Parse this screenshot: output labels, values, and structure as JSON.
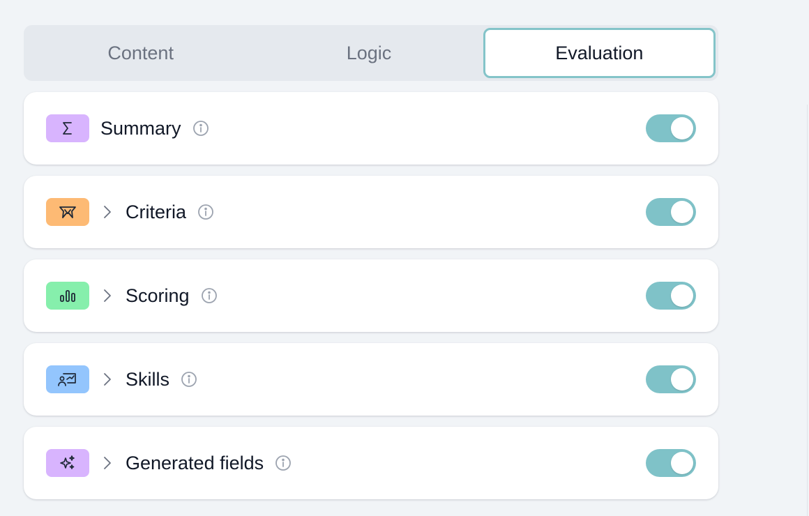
{
  "tabs": {
    "items": [
      {
        "label": "Content"
      },
      {
        "label": "Logic"
      },
      {
        "label": "Evaluation"
      }
    ],
    "active": "Evaluation"
  },
  "sections": [
    {
      "label": "Summary",
      "icon": "sigma-icon",
      "badge_color": "#d8b4fe",
      "expandable": false,
      "enabled": true
    },
    {
      "label": "Criteria",
      "icon": "criteria-icon",
      "badge_color": "#fdba74",
      "expandable": true,
      "enabled": true
    },
    {
      "label": "Scoring",
      "icon": "bar-chart-icon",
      "badge_color": "#86efac",
      "expandable": true,
      "enabled": true
    },
    {
      "label": "Skills",
      "icon": "skills-presentation-icon",
      "badge_color": "#93c5fd",
      "expandable": true,
      "enabled": true
    },
    {
      "label": "Generated fields",
      "icon": "sparkles-icon",
      "badge_color": "#d8b4fe",
      "expandable": true,
      "enabled": true
    }
  ],
  "colors": {
    "toggle_on": "#7fc2c8",
    "active_tab_border": "#84c4c9"
  }
}
